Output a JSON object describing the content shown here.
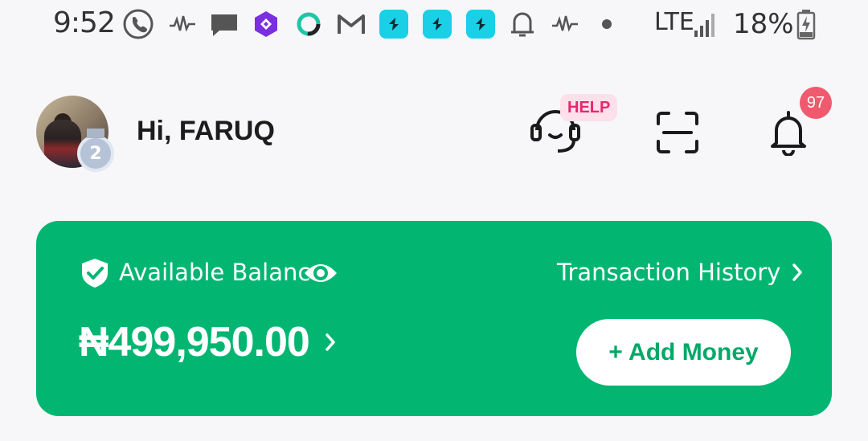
{
  "status_bar": {
    "time": "9:52",
    "network": "LTE",
    "battery": "18%",
    "icons": [
      "phone-call-icon",
      "activity-wave-icon",
      "message-icon",
      "purple-app-icon",
      "circle-app-icon",
      "gmail-icon",
      "fast-app-icon",
      "fast-app-icon",
      "fast-app-icon",
      "bell-icon",
      "activity-wave-icon",
      "dot-icon",
      "signal-icon",
      "battery-charging-icon"
    ]
  },
  "header": {
    "greeting": "Hi, FARUQ",
    "level": "2",
    "help_badge": "HELP",
    "notification_count": "97"
  },
  "balance_card": {
    "label": "Available Balance",
    "amount": "₦499,950.00",
    "amount_chevron": "›",
    "transaction_history": "Transaction History",
    "tx_chevron": "›",
    "add_money": "+ Add Money"
  },
  "colors": {
    "card": "#02b672",
    "help_badge_bg": "#fde0ea",
    "help_badge_text": "#e8266e",
    "notif_badge": "#f05a6e",
    "fast_app": "#1ad0e6"
  }
}
